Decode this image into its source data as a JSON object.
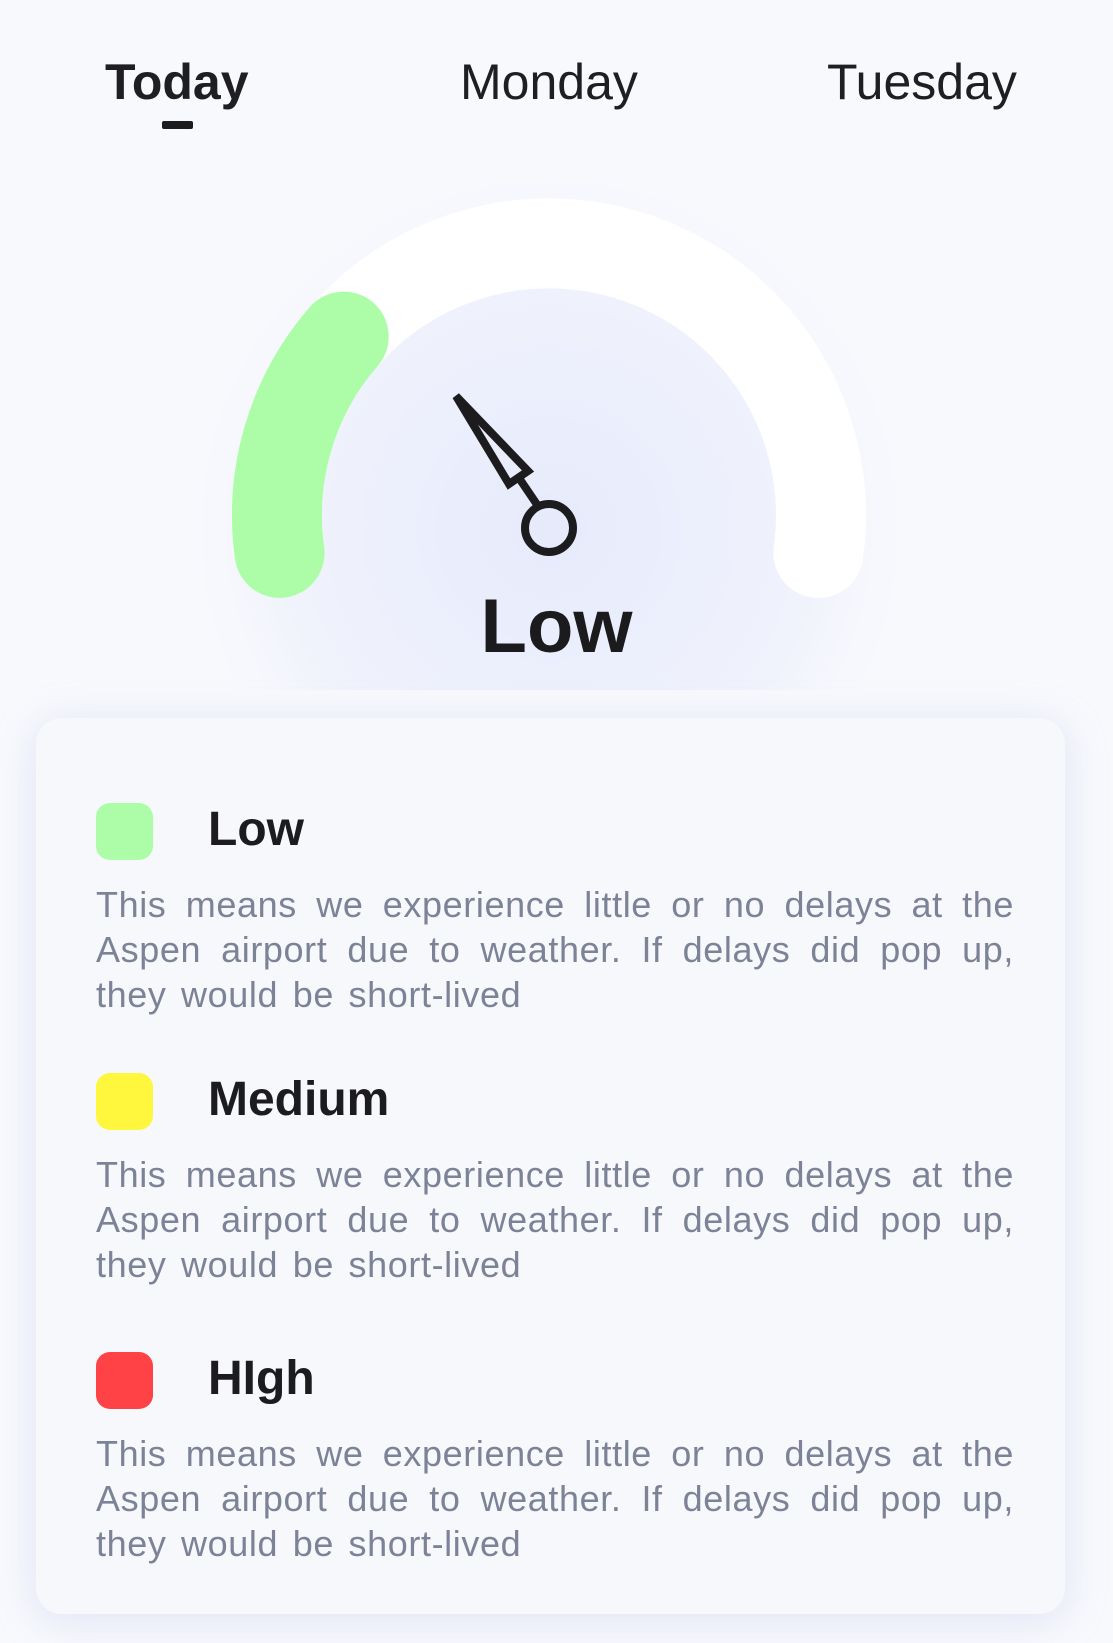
{
  "tabs": [
    {
      "label": "Today",
      "active": true
    },
    {
      "label": "Monday",
      "active": false
    },
    {
      "label": "Tuesday",
      "active": false
    }
  ],
  "gauge": {
    "level_label": "Low",
    "fill_fraction": 0.25,
    "fill_color": "#adfda8",
    "track_color": "#ffffff",
    "needle_color": "#1c1c1e"
  },
  "legend": {
    "items": [
      {
        "title": "Low",
        "color": "#adfda8",
        "description": "This means we experience little or no delays at the Aspen airport due to weather. If delays did pop up, they would be short-lived"
      },
      {
        "title": "Medium",
        "color": "#fef73d",
        "description": "This means we experience little or no delays at the Aspen airport due to weather. If delays did pop up, they would be short-lived"
      },
      {
        "title": "HIgh",
        "color": "#ff4245",
        "description": "This means we experience little or no delays at the Aspen airport due to weather. If delays did pop up, they would be short-lived"
      }
    ]
  }
}
